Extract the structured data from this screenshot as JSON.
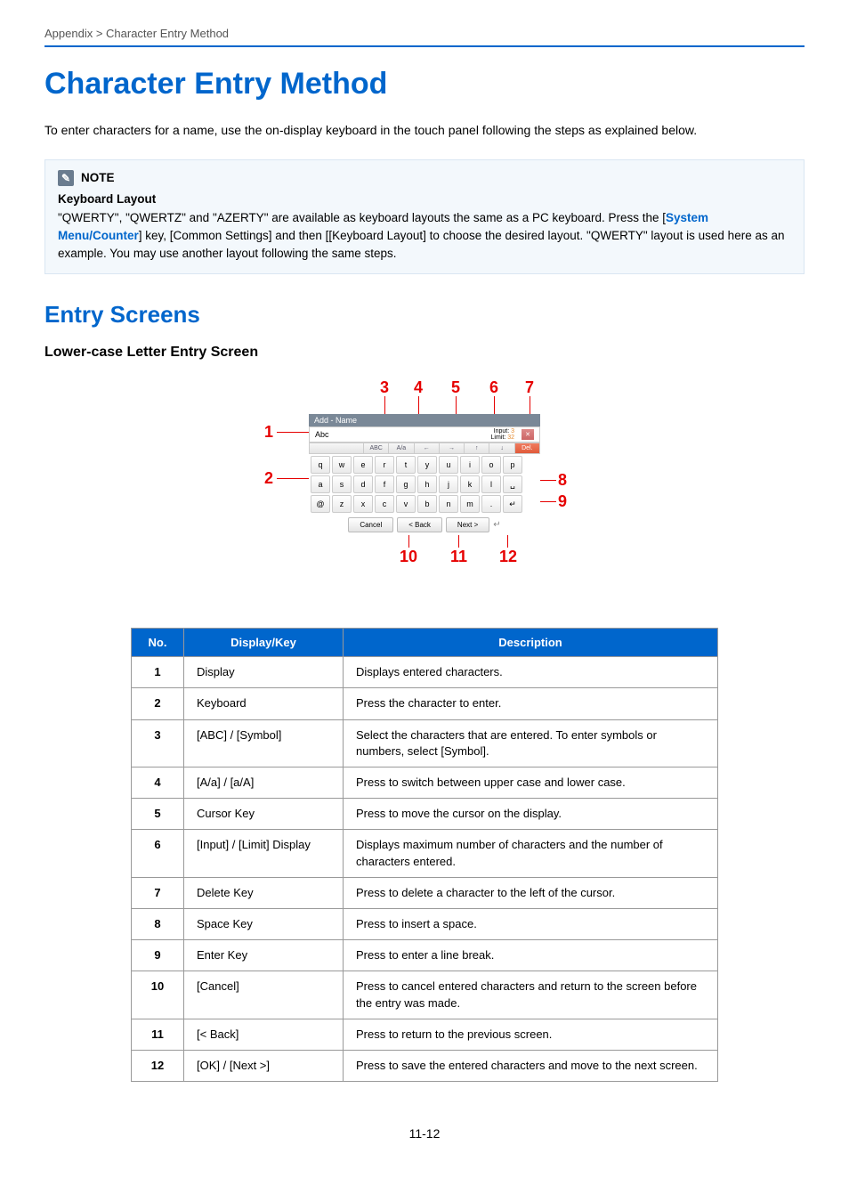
{
  "breadcrumb": "Appendix > Character Entry Method",
  "title": "Character Entry Method",
  "intro": "To enter characters for a name, use the on-display keyboard in the touch panel following the steps as explained below.",
  "note": {
    "label": "NOTE",
    "heading": "Keyboard Layout",
    "line1_a": "\"QWERTY\", \"QWERTZ\" and \"AZERTY\" are available as keyboard layouts the same as a PC keyboard. Press the [",
    "link": "System Menu/Counter",
    "line1_b": "] key, [Common Settings] and then [[Keyboard Layout] to choose the desired layout. \"QWERTY\" layout is used here as an example. You may use another layout following the same steps."
  },
  "section": "Entry Screens",
  "sub": "Lower-case Letter Entry Screen",
  "diagram": {
    "panel_title": "Add - Name",
    "display_text": "Abc",
    "input_label": "Input:",
    "input_value": "3",
    "limit_label": "Limit:",
    "limit_value": "32",
    "tb_abc": "ABC",
    "tb_aa": "A/a",
    "tb_left": "←",
    "tb_right": "→",
    "tb_up": "↑",
    "tb_down": "↓",
    "tb_del": "Del.",
    "tb_x": "✕",
    "row1": [
      "q",
      "w",
      "e",
      "r",
      "t",
      "y",
      "u",
      "i",
      "o",
      "p"
    ],
    "row2": [
      "a",
      "s",
      "d",
      "f",
      "g",
      "h",
      "j",
      "k",
      "l",
      "␣"
    ],
    "row3": [
      "@",
      "z",
      "x",
      "c",
      "v",
      "b",
      "n",
      "m",
      ".",
      "↵"
    ],
    "cancel": "Cancel",
    "back": "< Back",
    "next": "Next >",
    "enter_icon": "↵"
  },
  "callouts": {
    "c1": "1",
    "c2": "2",
    "c3": "3",
    "c4": "4",
    "c5": "5",
    "c6": "6",
    "c7": "7",
    "c8": "8",
    "c9": "9",
    "c10": "10",
    "c11": "11",
    "c12": "12"
  },
  "table": {
    "headers": {
      "no": "No.",
      "dk": "Display/Key",
      "desc": "Description"
    },
    "rows": [
      {
        "no": "1",
        "dk": "Display",
        "desc": "Displays entered characters."
      },
      {
        "no": "2",
        "dk": "Keyboard",
        "desc": "Press the character to enter."
      },
      {
        "no": "3",
        "dk": "[ABC] / [Symbol]",
        "desc": "Select the characters that are entered. To enter symbols or numbers, select [Symbol]."
      },
      {
        "no": "4",
        "dk": "[A/a] / [a/A]",
        "desc": "Press to switch between upper case and lower case."
      },
      {
        "no": "5",
        "dk": "Cursor Key",
        "desc": "Press to move the cursor on the display."
      },
      {
        "no": "6",
        "dk": "[Input] / [Limit] Display",
        "desc": "Displays maximum number of characters and the number of characters entered."
      },
      {
        "no": "7",
        "dk": "Delete Key",
        "desc": "Press to delete a character to the left of the cursor."
      },
      {
        "no": "8",
        "dk": "Space Key",
        "desc": "Press to insert a space."
      },
      {
        "no": "9",
        "dk": "Enter Key",
        "desc": "Press to enter a line break."
      },
      {
        "no": "10",
        "dk": "[Cancel]",
        "desc": "Press to cancel entered characters and return to the screen before the entry was made."
      },
      {
        "no": "11",
        "dk": "[< Back]",
        "desc": "Press to return to the previous screen."
      },
      {
        "no": "12",
        "dk": "[OK] / [Next >]",
        "desc": "Press to save the entered characters and move to the next screen."
      }
    ]
  },
  "page_num": "11-12"
}
